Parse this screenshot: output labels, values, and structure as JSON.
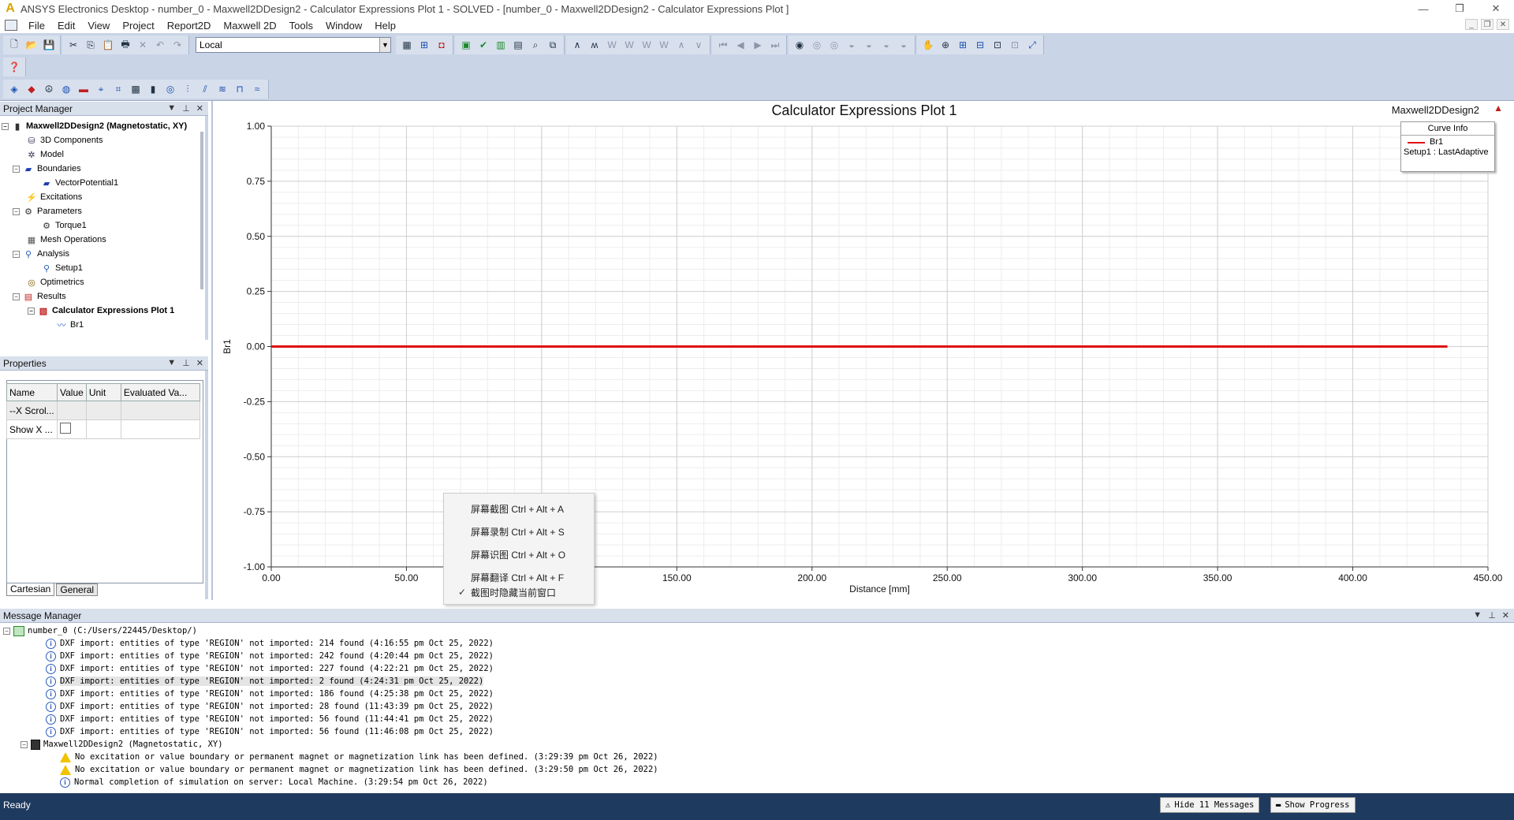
{
  "window": {
    "title": "ANSYS Electronics Desktop - number_0 - Maxwell2DDesign2 - Calculator Expressions Plot 1 - SOLVED - [number_0 - Maxwell2DDesign2 - Calculator Expressions Plot ]",
    "controls": [
      "—",
      "❐",
      "✕"
    ]
  },
  "menu": {
    "items": [
      "File",
      "Edit",
      "View",
      "Project",
      "Report2D",
      "Maxwell 2D",
      "Tools",
      "Window",
      "Help"
    ]
  },
  "toolbar": {
    "coord_system": "Local"
  },
  "project_manager": {
    "title": "Project Manager",
    "tree": [
      {
        "label": "Maxwell2DDesign2 (Magnetostatic, XY)",
        "icon": "design-icon"
      },
      {
        "label": "3D Components",
        "icon": "components-icon"
      },
      {
        "label": "Model",
        "icon": "model-icon"
      },
      {
        "label": "Boundaries",
        "icon": "boundary-icon"
      },
      {
        "label": "VectorPotential1",
        "icon": "boundary-icon"
      },
      {
        "label": "Excitations",
        "icon": "excitation-icon"
      },
      {
        "label": "Parameters",
        "icon": "parameter-icon"
      },
      {
        "label": "Torque1",
        "icon": "torque-icon"
      },
      {
        "label": "Mesh Operations",
        "icon": "mesh-icon"
      },
      {
        "label": "Analysis",
        "icon": "analysis-icon"
      },
      {
        "label": "Setup1",
        "icon": "setup-icon"
      },
      {
        "label": "Optimetrics",
        "icon": "optimetrics-icon"
      },
      {
        "label": "Results",
        "icon": "results-icon"
      },
      {
        "label": "Calculator Expressions Plot 1",
        "icon": "plot-icon"
      },
      {
        "label": "Br1",
        "icon": "trace-icon"
      }
    ]
  },
  "properties": {
    "title": "Properties",
    "columns": [
      "Name",
      "Value",
      "Unit",
      "Evaluated Va..."
    ],
    "rows": [
      [
        "--X Scrol...",
        "",
        "",
        ""
      ],
      [
        "Show X ...",
        "",
        "",
        ""
      ]
    ],
    "tabs": [
      "Cartesian",
      "General"
    ]
  },
  "plot": {
    "design_name": "Maxwell2DDesign2",
    "legend": {
      "title": "Curve Info",
      "series_name": "Br1",
      "series_sub": "Setup1 : LastAdaptive"
    }
  },
  "chart_data": {
    "type": "line",
    "title": "Calculator Expressions Plot 1",
    "xlabel": "Distance [mm]",
    "ylabel": "Br1",
    "xlim": [
      0,
      450
    ],
    "ylim": [
      -1,
      1
    ],
    "xticks": [
      "0.00",
      "50.00",
      "100.00",
      "150.00",
      "200.00",
      "250.00",
      "300.00",
      "350.00",
      "400.00",
      "450.00"
    ],
    "yticks": [
      "1.00",
      "0.75",
      "0.50",
      "0.25",
      "0.00",
      "-0.25",
      "-0.50",
      "-0.75",
      "-1.00"
    ],
    "grid": true,
    "legend_position": "top-right",
    "series": [
      {
        "name": "Br1",
        "color": "#e01010",
        "x": [
          0,
          435
        ],
        "y": [
          0,
          0
        ]
      }
    ]
  },
  "context_menu": {
    "items": [
      {
        "label": "屏幕截图 Ctrl + Alt + A",
        "checked": false
      },
      {
        "label": "屏幕录制 Ctrl + Alt + S",
        "checked": false
      },
      {
        "label": "屏幕识图 Ctrl + Alt + O",
        "checked": false
      },
      {
        "label": "屏幕翻译 Ctrl + Alt + F",
        "checked": false
      },
      {
        "label": "截图时隐藏当前窗口",
        "checked": true
      }
    ]
  },
  "messages": {
    "title": "Message Manager",
    "project": "number_0 (C:/Users/22445/Desktop/)",
    "project_msgs": [
      "DXF import: entities of type 'REGION' not imported: 214 found (4:16:55 pm  Oct 25, 2022)",
      "DXF import: entities of type 'REGION' not imported: 242 found (4:20:44 pm  Oct 25, 2022)",
      "DXF import: entities of type 'REGION' not imported: 227 found (4:22:21 pm  Oct 25, 2022)",
      "DXF import: entities of type 'REGION' not imported: 2 found (4:24:31 pm  Oct 25, 2022)",
      "DXF import: entities of type 'REGION' not imported: 186 found (4:25:38 pm  Oct 25, 2022)",
      "DXF import: entities of type 'REGION' not imported: 28 found (11:43:39 pm  Oct 25, 2022)",
      "DXF import: entities of type 'REGION' not imported: 56 found (11:44:41 pm  Oct 25, 2022)",
      "DXF import: entities of type 'REGION' not imported: 56 found (11:46:08 pm  Oct 25, 2022)"
    ],
    "design": "Maxwell2DDesign2 (Magnetostatic, XY)",
    "design_msgs": [
      {
        "type": "warning",
        "text": "No excitation or value boundary or permanent magnet or magnetization link has been defined. (3:29:39 pm  Oct 26, 2022)"
      },
      {
        "type": "warning",
        "text": "No excitation or value boundary or permanent magnet or magnetization link has been defined. (3:29:50 pm  Oct 26, 2022)"
      },
      {
        "type": "info",
        "text": "Normal completion of simulation on server: Local Machine. (3:29:54 pm  Oct 26, 2022)"
      }
    ]
  },
  "status": {
    "text": "Ready",
    "hide_messages": "Hide 11 Messages",
    "show_progress": "Show Progress"
  }
}
